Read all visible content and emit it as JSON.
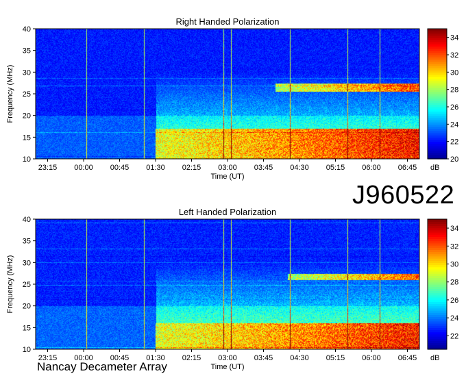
{
  "observation_id": "J960522",
  "observatory": "Nancay Decameter Array",
  "colors": {
    "colormap": [
      "#00008f",
      "#0000ff",
      "#0080ff",
      "#00ffff",
      "#80ff80",
      "#ffff00",
      "#ff8000",
      "#ff0000",
      "#800000"
    ]
  },
  "chart_data": [
    {
      "type": "heatmap",
      "title": "Right Handed Polarization",
      "xlabel": "Time (UT)",
      "ylabel": "Frequency (MHz)",
      "x_ticks": [
        "23:15",
        "00:00",
        "00:45",
        "01:30",
        "02:15",
        "03:00",
        "03:45",
        "04:30",
        "05:15",
        "06:00",
        "06:45"
      ],
      "y_ticks": [
        10,
        15,
        20,
        25,
        30,
        35,
        40
      ],
      "ylim": [
        10,
        40
      ],
      "colorbar": {
        "label": "dB",
        "ticks": [
          20,
          22,
          24,
          26,
          28,
          30,
          32,
          34
        ],
        "range": [
          20,
          35
        ]
      },
      "time_range": [
        "23:00",
        "07:00"
      ],
      "bursts": [
        {
          "f_low": 10,
          "f_high": 17,
          "t_start": "01:30",
          "t_end": "07:00",
          "level_db": 32
        },
        {
          "f_low": 25.5,
          "f_high": 27.5,
          "t_start": "04:00",
          "t_end": "07:00",
          "level_db": 31
        }
      ]
    },
    {
      "type": "heatmap",
      "title": "Left Handed Polarization",
      "xlabel": "Time (UT)",
      "ylabel": "Frequency (MHz)",
      "x_ticks": [
        "23:15",
        "00:00",
        "00:45",
        "01:30",
        "02:15",
        "03:00",
        "03:45",
        "04:30",
        "05:15",
        "06:00",
        "06:45"
      ],
      "y_ticks": [
        10,
        15,
        20,
        25,
        30,
        35,
        40
      ],
      "ylim": [
        10,
        40
      ],
      "colorbar": {
        "label": "dB",
        "ticks": [
          22,
          24,
          26,
          28,
          30,
          32,
          34
        ],
        "range": [
          20.5,
          35
        ]
      },
      "time_range": [
        "23:00",
        "07:00"
      ],
      "bursts": [
        {
          "f_low": 10,
          "f_high": 16,
          "t_start": "01:30",
          "t_end": "07:00",
          "level_db": 32
        },
        {
          "f_low": 26,
          "f_high": 27.5,
          "t_start": "04:15",
          "t_end": "07:00",
          "level_db": 31
        }
      ]
    }
  ]
}
